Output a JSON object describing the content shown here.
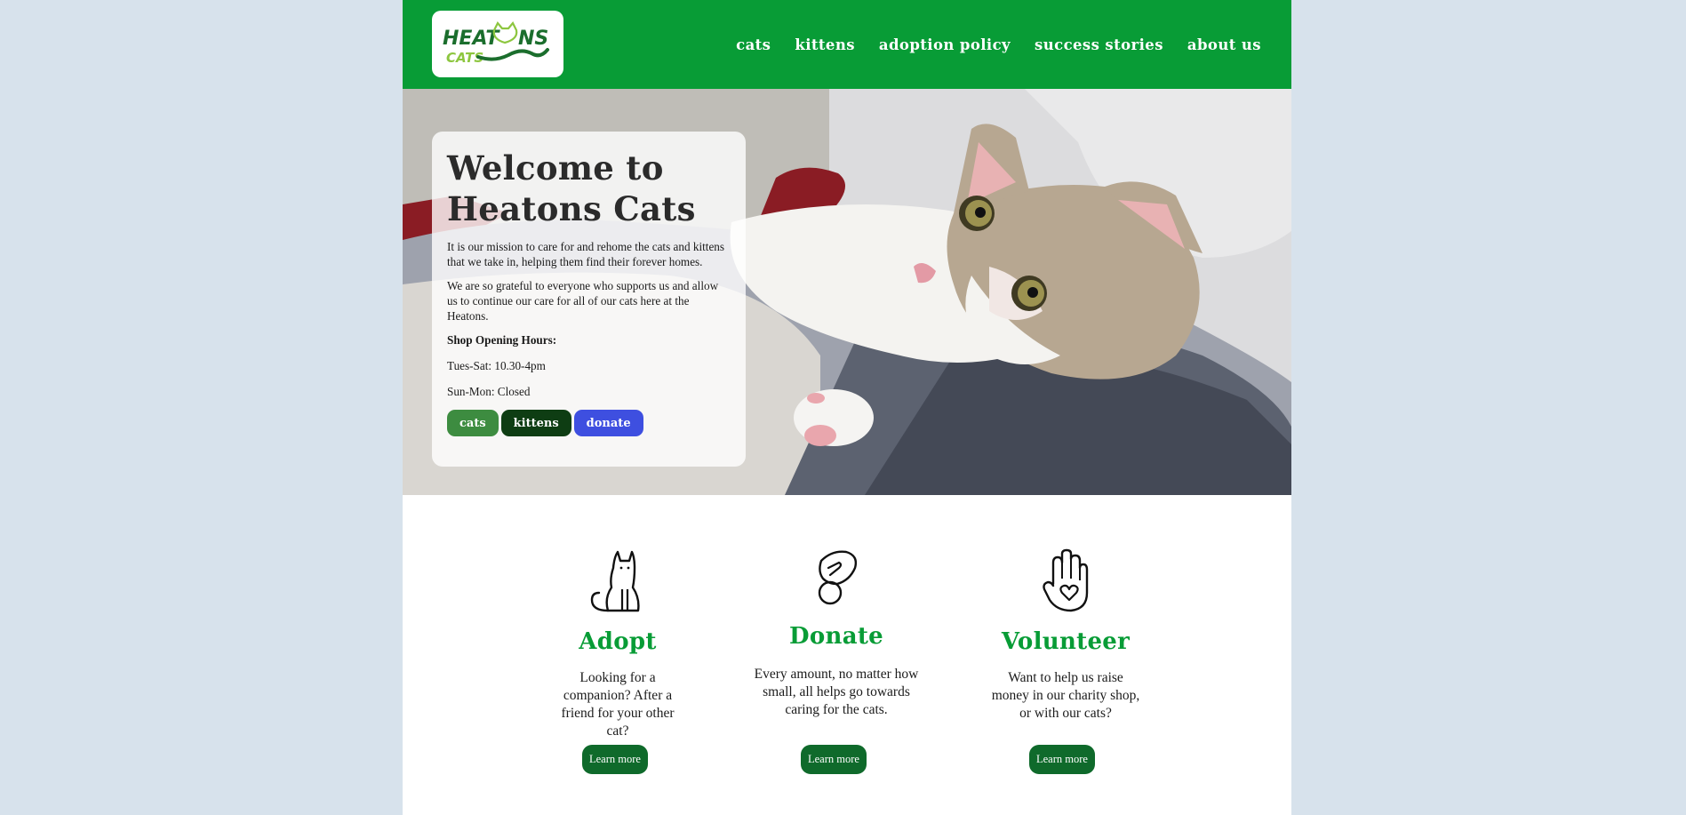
{
  "brand": {
    "logo_alt": "Heatons Cats",
    "logo_word_1": "HEAT",
    "logo_word_2": "NS",
    "logo_word_3": "CATS",
    "colors": {
      "primary": "#089c36",
      "dark_green": "#0f6a2b",
      "donate_blue": "#3e4fe0",
      "page_bg": "#d7e2ec"
    }
  },
  "nav": {
    "items": [
      {
        "label": "cats"
      },
      {
        "label": "kittens"
      },
      {
        "label": "adoption policy"
      },
      {
        "label": "success stories"
      },
      {
        "label": "about us"
      }
    ]
  },
  "hero": {
    "title": "Welcome to Heatons Cats",
    "paragraph_1": "It is our mission to care for and rehome the cats and kittens that we take in, helping them find their forever homes.",
    "paragraph_2": "We are so grateful to everyone who supports us and allow us to continue our care for all of our cats here at the Heatons.",
    "hours_heading": "Shop Opening Hours:",
    "hours_1": "Tues-Sat: 10.30-4pm",
    "hours_2": "Sun-Mon: Closed",
    "buttons": {
      "cats": "cats",
      "kittens": "kittens",
      "donate": "donate"
    },
    "image": "photo of a white and tabby kitten lying on a knitted blanket"
  },
  "features": [
    {
      "icon": "cat-icon",
      "title": "Adopt",
      "text": "Looking for a companion? After a friend for your other cat?",
      "button": "Learn more"
    },
    {
      "icon": "coin-hand-icon",
      "title": "Donate",
      "text": "Every amount, no matter how small, all helps go towards caring for the cats.",
      "button": "Learn more"
    },
    {
      "icon": "heart-hand-icon",
      "title": "Volunteer",
      "text": "Want to help us raise money in our charity shop, or with our cats?",
      "button": "Learn more"
    }
  ]
}
